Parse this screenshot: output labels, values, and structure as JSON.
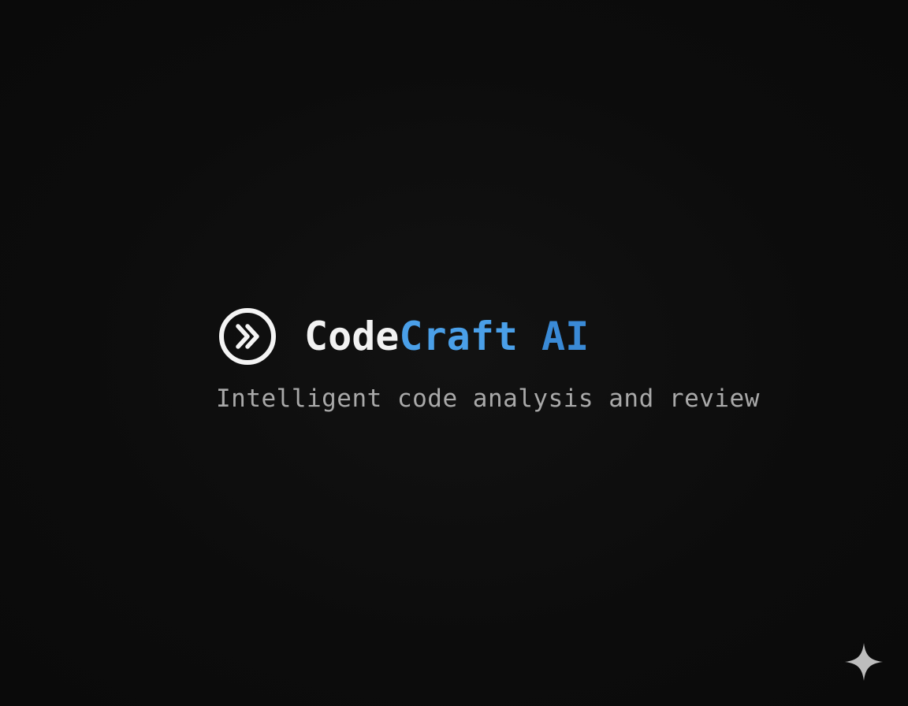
{
  "brand": {
    "name_part1": "Code",
    "name_part2": "Craft",
    "name_part3": " AI",
    "tagline": "Intelligent code analysis and review"
  },
  "icons": {
    "logo": "double-chevron-right-circle-icon",
    "corner": "sparkle-icon"
  },
  "colors": {
    "background": "#0d0d0d",
    "title_primary": "#f2f2f2",
    "title_accent": "#4a9fe8",
    "tagline": "#a9a9a9"
  }
}
